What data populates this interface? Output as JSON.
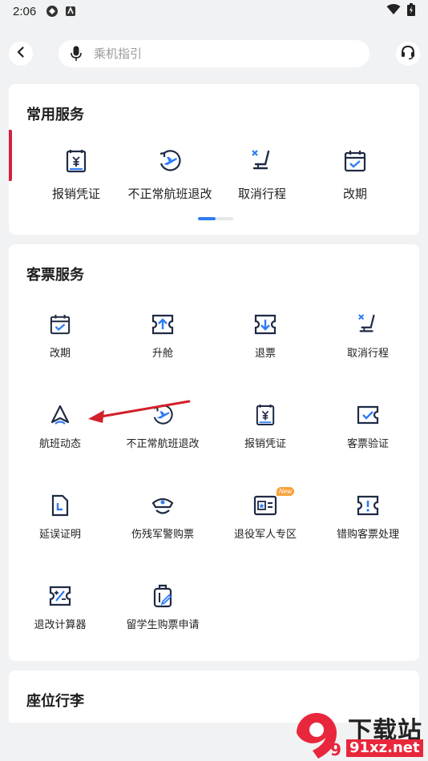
{
  "status_bar": {
    "time": "2:06"
  },
  "search": {
    "placeholder": "乘机指引"
  },
  "common_services": {
    "title": "常用服务",
    "items": [
      {
        "label": "报销凭证",
        "icon": "receipt-icon"
      },
      {
        "label": "不正常航班退改",
        "icon": "flight-irregular-icon"
      },
      {
        "label": "取消行程",
        "icon": "cancel-seat-icon"
      },
      {
        "label": "改期",
        "icon": "calendar-check-icon"
      }
    ],
    "page_index": 1,
    "page_count": 2
  },
  "ticket_services": {
    "title": "客票服务",
    "items": [
      {
        "label": "改期",
        "icon": "calendar-check-icon"
      },
      {
        "label": "升舱",
        "icon": "upgrade-ticket-icon"
      },
      {
        "label": "退票",
        "icon": "refund-ticket-icon"
      },
      {
        "label": "取消行程",
        "icon": "cancel-seat-icon"
      },
      {
        "label": "航班动态",
        "icon": "flight-status-icon"
      },
      {
        "label": "不正常航班退改",
        "icon": "flight-irregular-icon"
      },
      {
        "label": "报销凭证",
        "icon": "receipt-icon"
      },
      {
        "label": "客票验证",
        "icon": "ticket-verify-icon"
      },
      {
        "label": "延误证明",
        "icon": "delay-proof-icon"
      },
      {
        "label": "伤残军警购票",
        "icon": "military-police-icon"
      },
      {
        "label": "退役军人专区",
        "icon": "veteran-id-icon",
        "badge": "New"
      },
      {
        "label": "错购客票处理",
        "icon": "wrong-ticket-icon"
      },
      {
        "label": "退改计算器",
        "icon": "calculator-icon"
      },
      {
        "label": "留学生购票申请",
        "icon": "student-luggage-icon"
      }
    ]
  },
  "seat_baggage": {
    "title": "座位行李"
  },
  "watermark": {
    "title": "下载站",
    "domain": "91xz.net",
    "logo_text": "9"
  },
  "colors": {
    "accent": "#2f7cf6",
    "brand_red": "#d51f3d",
    "icon_dark": "#1f2a44"
  }
}
